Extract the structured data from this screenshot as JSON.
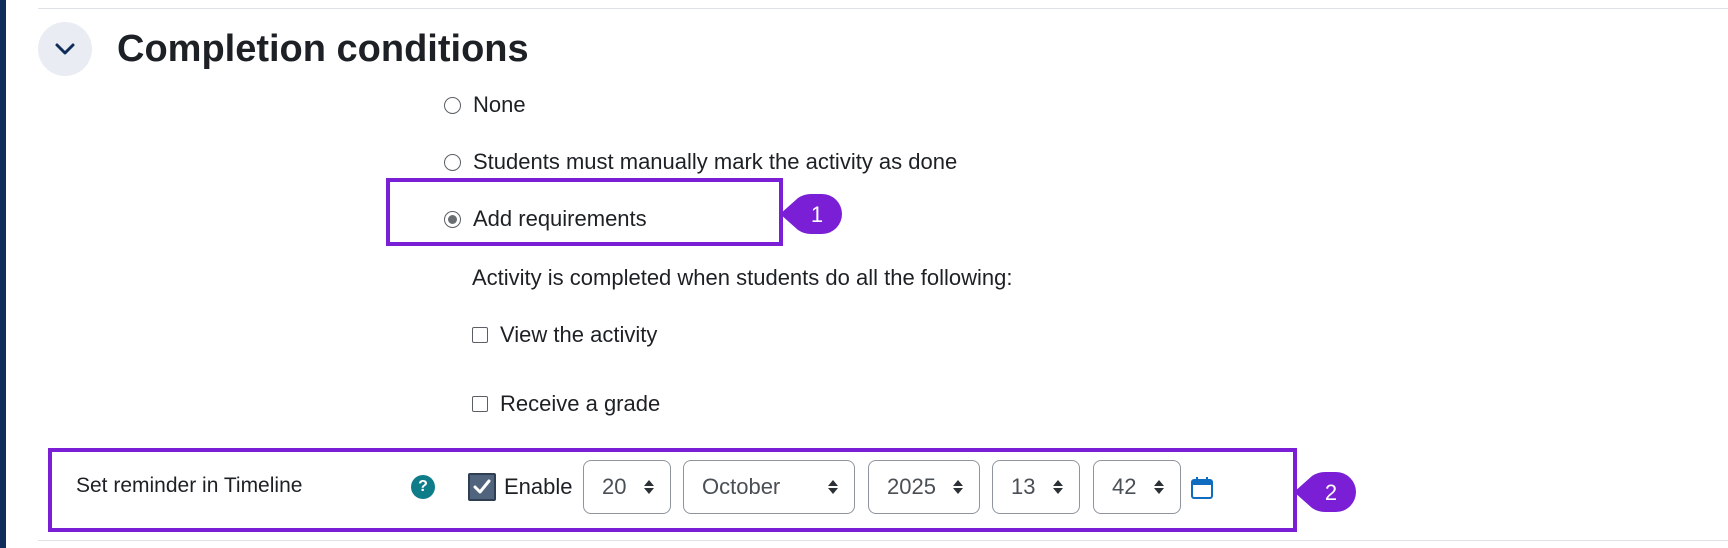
{
  "section": {
    "title": "Completion conditions",
    "collapse_icon": "chevron-down-icon"
  },
  "options": {
    "none": "None",
    "manual": "Students must manually mark the activity as done",
    "requirements": "Add requirements",
    "selected": "requirements"
  },
  "requirements": {
    "description": "Activity is completed when students do all the following:",
    "view_activity": "View the activity",
    "receive_grade": "Receive a grade"
  },
  "reminder": {
    "label": "Set reminder in Timeline",
    "help_icon": "question-circle-icon",
    "help_glyph": "?",
    "enable_label": "Enable",
    "enabled": true,
    "day": "20",
    "month": "October",
    "year": "2025",
    "hour": "13",
    "minute": "42",
    "calendar_icon": "calendar-icon"
  },
  "callouts": [
    "1",
    "2"
  ],
  "colors": {
    "highlight": "#7a1fd6",
    "help": "#0f7c8a",
    "calendar": "#0f6cbf"
  }
}
